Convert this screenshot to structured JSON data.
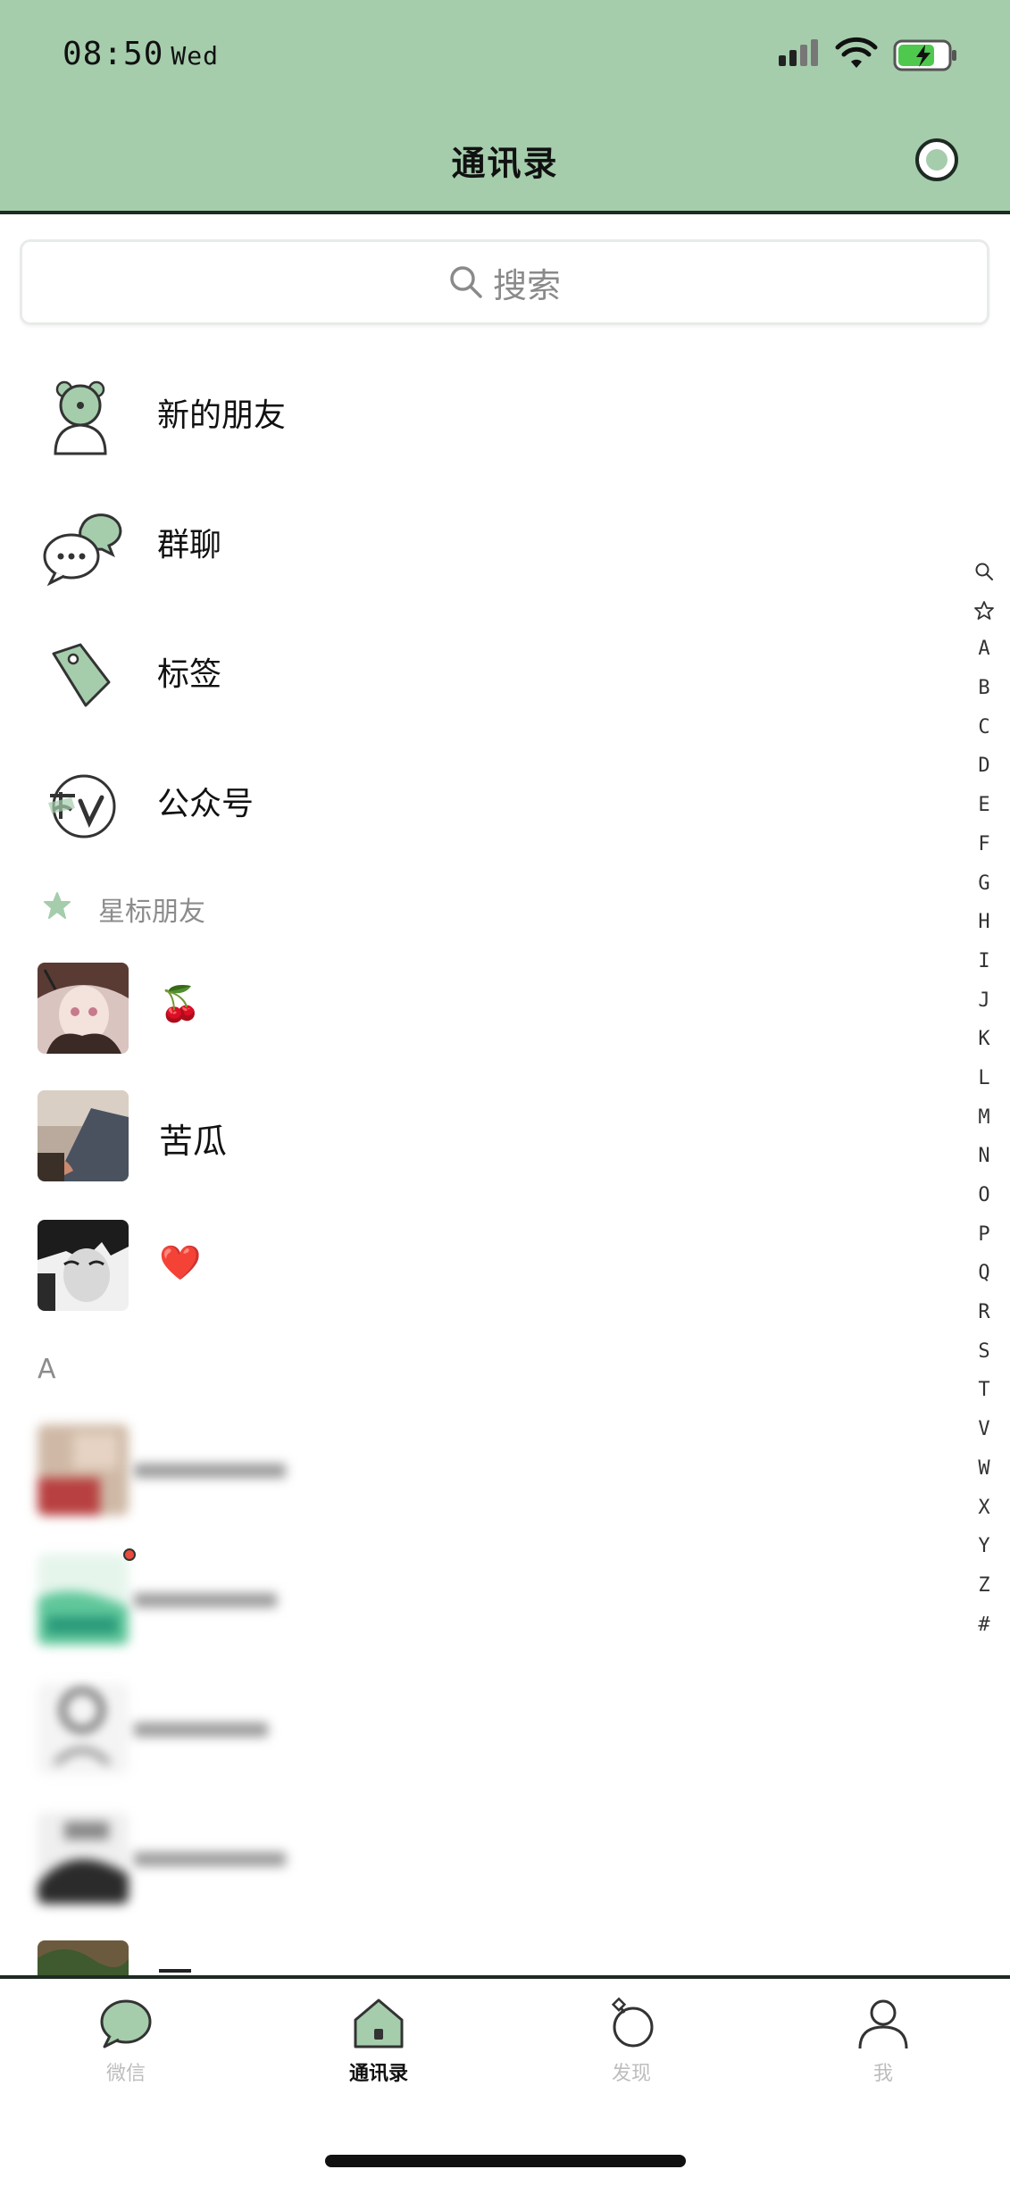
{
  "status": {
    "time": "08:50",
    "day": "Wed"
  },
  "header": {
    "title": "通讯录"
  },
  "search": {
    "placeholder": "搜索"
  },
  "features": [
    {
      "label": "新的朋友",
      "icon": "new-friend-icon"
    },
    {
      "label": "群聊",
      "icon": "group-chat-icon"
    },
    {
      "label": "标签",
      "icon": "tag-icon"
    },
    {
      "label": "公众号",
      "icon": "official-account-icon"
    }
  ],
  "starred": {
    "title": "星标朋友",
    "contacts": [
      {
        "name": "🍒"
      },
      {
        "name": "苦瓜"
      },
      {
        "name": "❤️"
      }
    ]
  },
  "section_a": {
    "title": "A"
  },
  "index": [
    "A",
    "B",
    "C",
    "D",
    "E",
    "F",
    "G",
    "H",
    "I",
    "J",
    "K",
    "L",
    "M",
    "N",
    "O",
    "P",
    "Q",
    "R",
    "S",
    "T",
    "V",
    "W",
    "X",
    "Y",
    "Z",
    "#"
  ],
  "tabs": [
    {
      "label": "微信",
      "icon": "chat-bubble-icon",
      "active": false
    },
    {
      "label": "通讯录",
      "icon": "contacts-icon",
      "active": true
    },
    {
      "label": "发现",
      "icon": "discover-icon",
      "active": false
    },
    {
      "label": "我",
      "icon": "person-icon",
      "active": false
    }
  ],
  "colors": {
    "header_bg": "#a5cdac",
    "accent": "#a5cdac",
    "dark": "#1d2b22"
  }
}
